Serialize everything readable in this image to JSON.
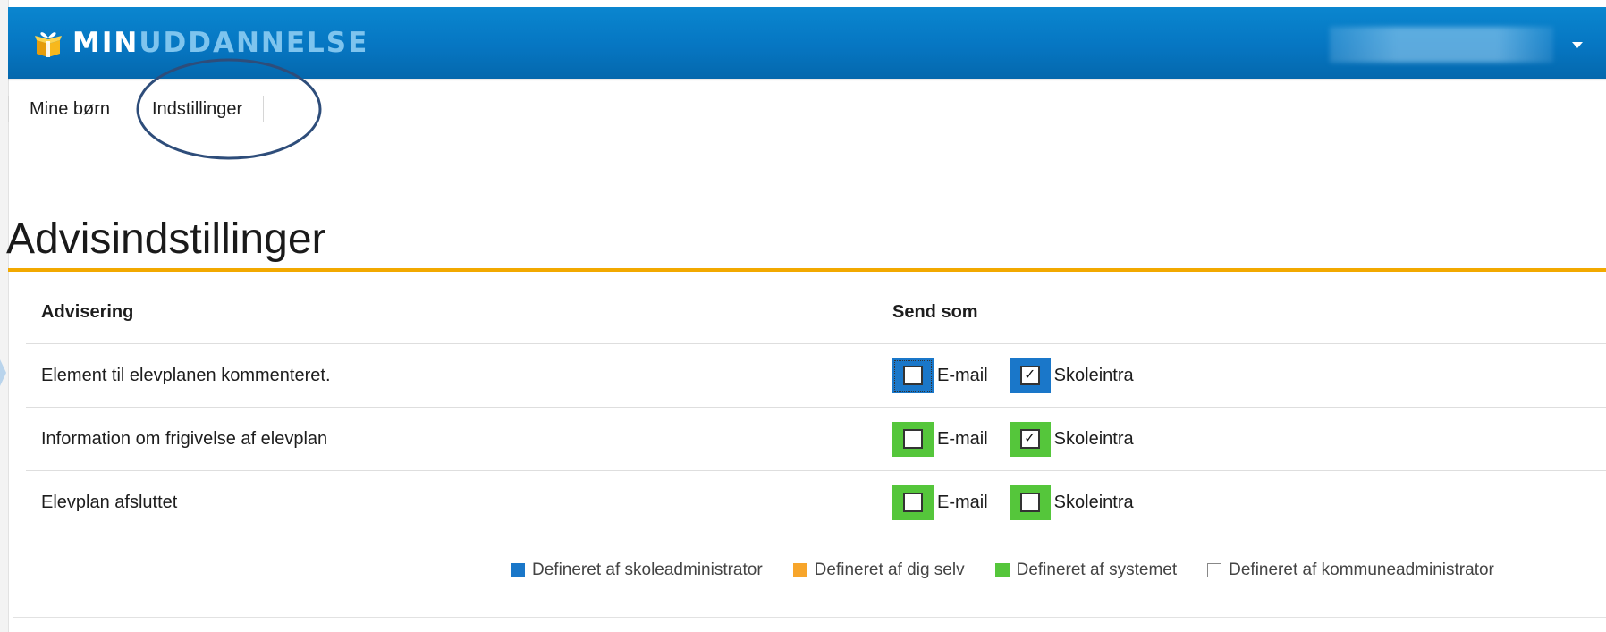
{
  "colors": {
    "header_blue": "#0676c2",
    "accent_orange": "#f2a900",
    "admin_blue": "#1a77c9",
    "self_orange": "#f7a52b",
    "system_green": "#55c63b",
    "municipal_white": "#ffffff"
  },
  "header": {
    "logo_icon": "gift-box-icon",
    "logo_min": "MIN",
    "logo_rest": "UDDANNELSE",
    "user_name": "",
    "menu_icon": "caret-down-icon"
  },
  "nav": {
    "items": [
      {
        "label": "Mine børn"
      },
      {
        "label": "Indstillinger"
      }
    ]
  },
  "page": {
    "title": "Advisindstillinger"
  },
  "table": {
    "headers": {
      "notification": "Advisering",
      "send_as": "Send som"
    },
    "rows": [
      {
        "label": "Element til elevplanen kommenteret.",
        "email": {
          "label": "E-mail",
          "checked": false,
          "source": "admin_blue"
        },
        "skoleintra": {
          "label": "Skoleintra",
          "checked": true,
          "source": "admin_blue"
        }
      },
      {
        "label": "Information om frigivelse af elevplan",
        "email": {
          "label": "E-mail",
          "checked": false,
          "source": "system_green"
        },
        "skoleintra": {
          "label": "Skoleintra",
          "checked": true,
          "source": "system_green"
        }
      },
      {
        "label": "Elevplan afsluttet",
        "email": {
          "label": "E-mail",
          "checked": false,
          "source": "system_green"
        },
        "skoleintra": {
          "label": "Skoleintra",
          "checked": false,
          "source": "system_green"
        }
      }
    ]
  },
  "legend": [
    {
      "label": "Defineret af skoleadministrator",
      "color": "#1a77c9"
    },
    {
      "label": "Defineret af dig selv",
      "color": "#f7a52b"
    },
    {
      "label": "Defineret af systemet",
      "color": "#55c63b"
    },
    {
      "label": "Defineret af kommuneadministrator",
      "color": "#ffffff"
    }
  ],
  "check_mark": "✓"
}
